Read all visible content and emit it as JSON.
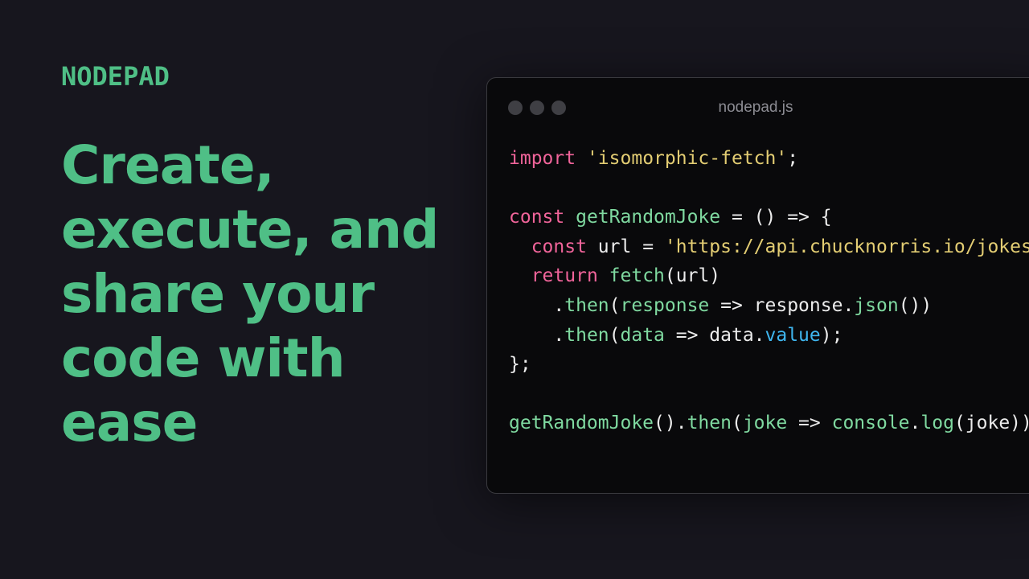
{
  "brand": {
    "name": "NODEPAD"
  },
  "hero": {
    "headline": "Create, execute, and share your code with ease"
  },
  "editor": {
    "filename": "nodepad.js",
    "lines": [
      [
        {
          "t": "import",
          "k": "keyword"
        },
        {
          "t": " ",
          "k": "plain"
        },
        {
          "t": "'isomorphic-fetch'",
          "k": "string"
        },
        {
          "t": ";",
          "k": "plain"
        }
      ],
      [],
      [
        {
          "t": "const",
          "k": "keyword"
        },
        {
          "t": " ",
          "k": "plain"
        },
        {
          "t": "getRandomJoke",
          "k": "func"
        },
        {
          "t": " = () => {",
          "k": "plain"
        }
      ],
      [
        {
          "t": "  ",
          "k": "plain"
        },
        {
          "t": "const",
          "k": "keyword"
        },
        {
          "t": " url = ",
          "k": "plain"
        },
        {
          "t": "'https://api.chucknorris.io/jokes/random'",
          "k": "string"
        },
        {
          "t": ";",
          "k": "plain"
        }
      ],
      [
        {
          "t": "  ",
          "k": "plain"
        },
        {
          "t": "return",
          "k": "keyword"
        },
        {
          "t": " ",
          "k": "plain"
        },
        {
          "t": "fetch",
          "k": "func"
        },
        {
          "t": "(url)",
          "k": "plain"
        }
      ],
      [
        {
          "t": "    .",
          "k": "plain"
        },
        {
          "t": "then",
          "k": "func"
        },
        {
          "t": "(",
          "k": "plain"
        },
        {
          "t": "response",
          "k": "func"
        },
        {
          "t": " => response.",
          "k": "plain"
        },
        {
          "t": "json",
          "k": "func"
        },
        {
          "t": "())",
          "k": "plain"
        }
      ],
      [
        {
          "t": "    .",
          "k": "plain"
        },
        {
          "t": "then",
          "k": "func"
        },
        {
          "t": "(",
          "k": "plain"
        },
        {
          "t": "data",
          "k": "func"
        },
        {
          "t": " => data.",
          "k": "plain"
        },
        {
          "t": "value",
          "k": "prop"
        },
        {
          "t": ");",
          "k": "plain"
        }
      ],
      [
        {
          "t": "};",
          "k": "plain"
        }
      ],
      [],
      [
        {
          "t": "getRandomJoke",
          "k": "func"
        },
        {
          "t": "().",
          "k": "plain"
        },
        {
          "t": "then",
          "k": "func"
        },
        {
          "t": "(",
          "k": "plain"
        },
        {
          "t": "joke",
          "k": "func"
        },
        {
          "t": " => ",
          "k": "plain"
        },
        {
          "t": "console",
          "k": "func"
        },
        {
          "t": ".",
          "k": "plain"
        },
        {
          "t": "log",
          "k": "func"
        },
        {
          "t": "(joke));",
          "k": "plain"
        }
      ]
    ]
  },
  "colors": {
    "background": "#17161e",
    "accent": "#4fbf86",
    "keyword": "#f0649a",
    "string": "#e3cd73",
    "func": "#7fd9a0",
    "prop": "#3fb6ef",
    "plain": "#ececec"
  }
}
